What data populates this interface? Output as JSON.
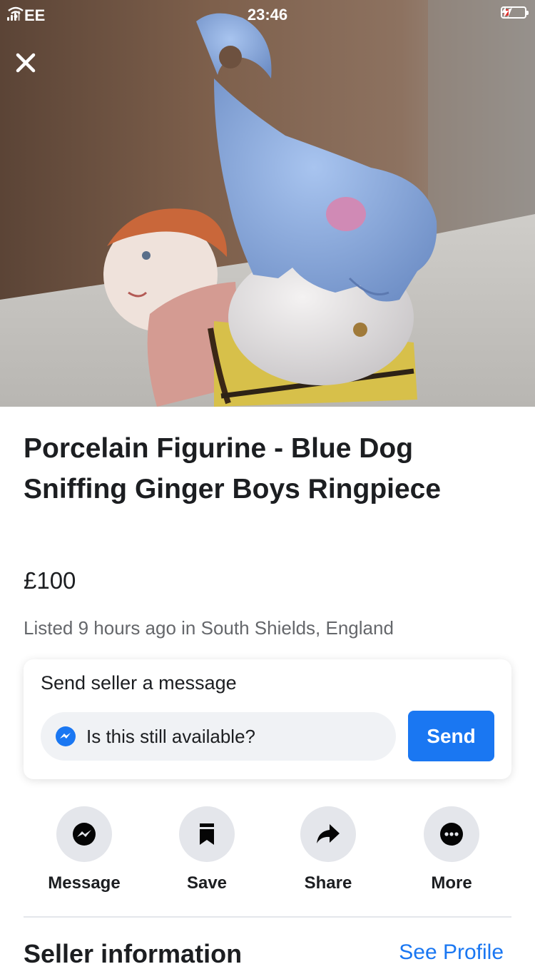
{
  "status_bar": {
    "carrier": "EE",
    "time": "23:46"
  },
  "listing": {
    "title": "Porcelain Figurine - Blue Dog Sniffing Ginger Boys Ringpiece",
    "price": "£100",
    "listed_info": "Listed 9 hours ago in South Shields, England"
  },
  "message_box": {
    "heading": "Send seller a message",
    "input_value": "Is this still available?",
    "send_label": "Send"
  },
  "actions": [
    {
      "label": "Message",
      "icon": "messenger-icon"
    },
    {
      "label": "Save",
      "icon": "bookmark-icon"
    },
    {
      "label": "Share",
      "icon": "share-arrow-icon"
    },
    {
      "label": "More",
      "icon": "more-dots-icon"
    }
  ],
  "seller_section": {
    "title": "Seller information",
    "link": "See Profile"
  },
  "colors": {
    "accent": "#1a77f2",
    "text": "#1c1e21",
    "muted": "#65676b",
    "icon_bg": "#e4e6eb"
  }
}
